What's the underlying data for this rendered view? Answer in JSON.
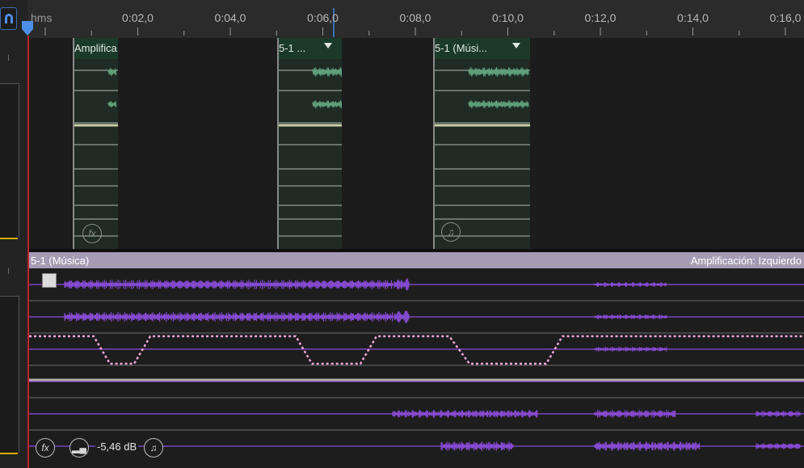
{
  "ruler": {
    "unit_label": "hms",
    "ticks": [
      "0:02,0",
      "0:04,0",
      "0:06,0",
      "0:08,0",
      "0:10,0",
      "0:12,0",
      "0:14,0",
      "0:16,0"
    ]
  },
  "track1": {
    "clips": [
      {
        "title": "Amplifica",
        "icon": "fx-icon",
        "has_dropdown": false
      },
      {
        "title": "5-1 ...",
        "icon": "",
        "has_dropdown": true
      },
      {
        "title": "5-1 (Músi...",
        "icon": "music-note-icon",
        "has_dropdown": true
      }
    ]
  },
  "track2": {
    "clip_title": "5-1 (Música)",
    "effect_label": "Amplificación: Izquierdo",
    "volume": "-5,46 dB",
    "icons": [
      "fx-icon",
      "volume-meter-icon",
      "music-note-icon"
    ]
  },
  "colors": {
    "waveform": "#8a4cd8",
    "clip_green": "#1b3a2a",
    "clip_header_lavender": "#a59bb4",
    "envelope": "#f0a8d8",
    "playhead": "#4d8fe6",
    "cursor_line": "#c0232a"
  }
}
